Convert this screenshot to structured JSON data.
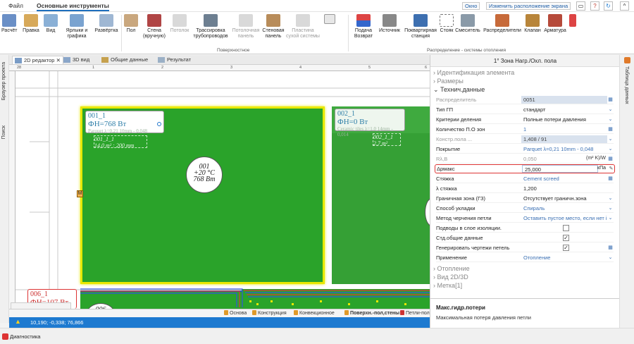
{
  "menubar": {
    "file": "Файл",
    "main_tools": "Основные инструменты",
    "window": "Окно",
    "change_layout": "Изменить расположение экрана"
  },
  "ribbon": {
    "buttons": {
      "calc": "Расчёт",
      "edit": "Правка",
      "view": "Вид",
      "labels": "Ярлыки и графика",
      "unfold": "Развёртка",
      "floor": "Пол",
      "wall_manual": "Стена (вручную)",
      "ceiling": "Потолок",
      "route": "Трассировка трубопроводов",
      "ceiling_panel": "Потолочная панель",
      "wall_panel": "Стеновая панель",
      "dry_plate": "Пластина сухой системы",
      "supply": "Подача Возврат",
      "source": "Источник",
      "apartment_station": "Поквартирная станция",
      "riser": "Стояк",
      "mixer": "Смеситель",
      "distributors": "Распределители",
      "valve": "Клапан",
      "fittings": "Арматура"
    },
    "groups": {
      "surface": "Поверхностное",
      "distribution": "Распределение - системы отопления"
    }
  },
  "left_tabs": [
    "Браузер проекта",
    "Поиск"
  ],
  "doc_tabs": [
    "2D редактор",
    "3D вид",
    "Общие данные",
    "Результат"
  ],
  "ruler": {
    "top_ticks": [
      "28",
      "1",
      "2",
      "3",
      "4",
      "5",
      "6"
    ]
  },
  "canvas": {
    "room1": {
      "id": "001_1",
      "fh": "ФН=768 Вт",
      "sub": "Parquet λ=0,21 10mm - 0,048",
      "zone": "001_1_1",
      "zone_area": "14,0 m² : 200 mm"
    },
    "room1_circle": {
      "line1": "001",
      "line2": "+20 °C",
      "line3": "768 Вт"
    },
    "room2": {
      "id": "002_1",
      "fh": "ФН=0 Вт",
      "sub": "Ceramic tiles λ=1,0 14mm - 0,014",
      "zone": "002_1_1",
      "zone_area": "2,7 m²"
    },
    "room3": {
      "id": "006_1",
      "fh": "ФН=107 Вт"
    },
    "room3_circle": "006",
    "marker": "M"
  },
  "layers": [
    "Основа",
    "Конструкция",
    "Конвекционное",
    "Поверхн.-пол,стены",
    "Петли-пол"
  ],
  "status": {
    "coords": "10,190; -0,338; 76,866"
  },
  "bottom_tab": "Диагностика",
  "props": {
    "title": "1° Зона Нагр./Охл. пола",
    "sections": {
      "ident": "Идентификация элемента",
      "size": "Размеры",
      "tech": "Технич.данные",
      "heating": "Отопление",
      "view": "Вид 2D/3D",
      "mark": "Метка[1]"
    },
    "rows": [
      {
        "k": "Распределитель",
        "v": "0051"
      },
      {
        "k": "Тип ГП",
        "v": "стандарт"
      },
      {
        "k": "Критерии деления",
        "v": "Полные потери давления"
      },
      {
        "k": "Количество П.О зон",
        "v": "1"
      },
      {
        "k": "Констр.пола ...",
        "v": "1,408 / 91"
      },
      {
        "k": "Покрытие",
        "v": "Parquet λ=0,21 10mm - 0,048"
      },
      {
        "k": "Rλ,B",
        "v": "0,050",
        "unit": "(m² K)/W"
      },
      {
        "k": "Δpмакс",
        "v": "25,000",
        "unit": "кПа"
      },
      {
        "k": "Стяжка",
        "v": "Cement screed"
      },
      {
        "k": "λ стяжка",
        "v": "1,200"
      },
      {
        "k": "Граничная зона (ГЗ)",
        "v": "Отсутствует граничн.зона"
      },
      {
        "k": "Способ укладки",
        "v": "Спираль"
      },
      {
        "k": "Метод черчения петли",
        "v": "Оставить пустое место, если нет і"
      },
      {
        "k": "Подводы в слое изоляции.",
        "v": ""
      },
      {
        "k": "Стд.общие данные",
        "v": ""
      },
      {
        "k": "Генерировать чертежи петель",
        "v": ""
      },
      {
        "k": "Применение",
        "v": "Отопление"
      }
    ],
    "desc_title": "Макс.гидр.потери",
    "desc_text": "Максимальная потеря давления петли"
  },
  "right_tab": "Таблица данных"
}
